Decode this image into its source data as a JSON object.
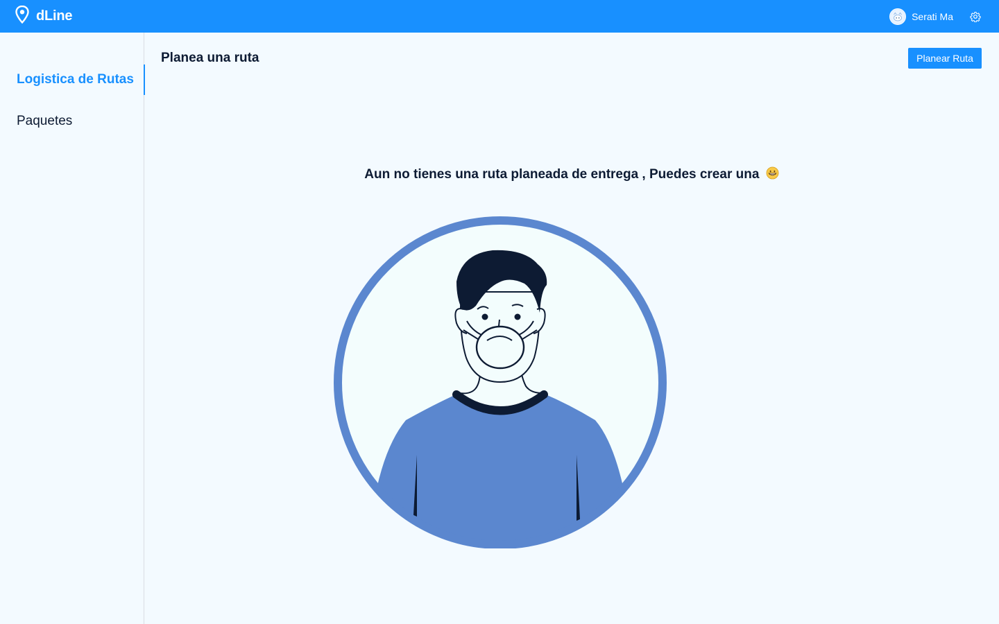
{
  "app": {
    "name": "dLine"
  },
  "header": {
    "user_name": "Serati Ma"
  },
  "sidebar": {
    "items": [
      {
        "label": "Logistica de Rutas",
        "active": true
      },
      {
        "label": "Paquetes",
        "active": false
      }
    ]
  },
  "main": {
    "title": "Planea una ruta",
    "primary_button": "Planear Ruta",
    "empty_message": "Aun no tienes una ruta planeada de entrega , Puedes crear una"
  },
  "colors": {
    "primary": "#1890ff",
    "background": "#f3faff",
    "illustration": "#5b87cf",
    "ink": "#0d1b33"
  },
  "icons": {
    "brand": "location-pin-icon",
    "settings": "gear-icon",
    "emoji": "grinning-face-emoji"
  }
}
